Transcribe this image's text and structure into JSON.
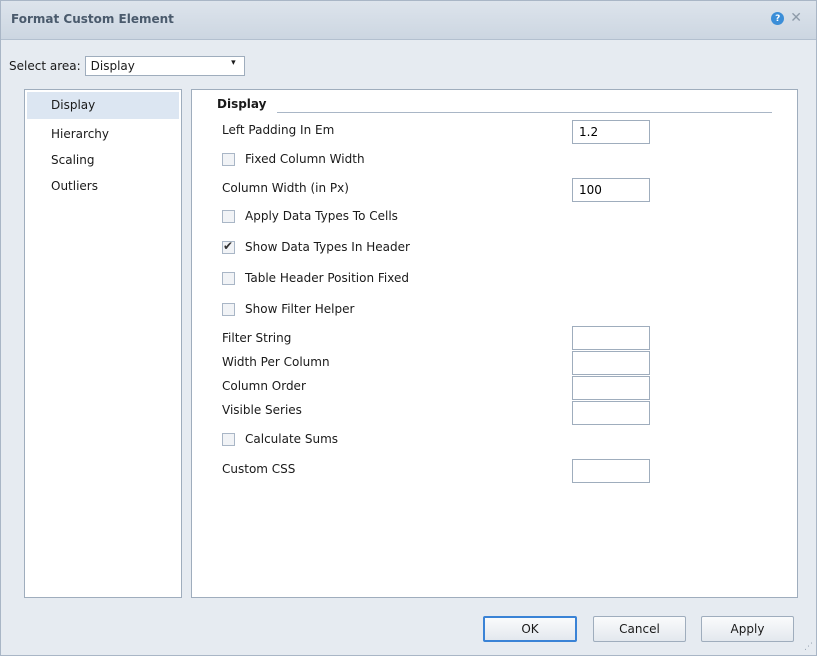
{
  "dialog": {
    "title": "Format Custom Element",
    "help_glyph": "?",
    "close_glyph": "✕"
  },
  "select_area": {
    "label": "Select area:",
    "value": "Display",
    "arrow": "▾"
  },
  "sidebar": {
    "items": [
      {
        "label": "Display",
        "active": true
      },
      {
        "label": "Hierarchy",
        "active": false
      },
      {
        "label": "Scaling",
        "active": false
      },
      {
        "label": "Outliers",
        "active": false
      }
    ]
  },
  "display": {
    "section_title": "Display",
    "left_padding": {
      "label": "Left Padding In Em",
      "value": "1.2"
    },
    "fixed_column_width": {
      "label": "Fixed Column Width",
      "checked": false
    },
    "column_width": {
      "label": "Column Width (in Px)",
      "value": "100"
    },
    "apply_data_types": {
      "label": "Apply Data Types To Cells",
      "checked": false
    },
    "show_data_types_header": {
      "label": "Show Data Types In Header",
      "checked": true
    },
    "table_header_fixed": {
      "label": "Table Header Position Fixed",
      "checked": false
    },
    "show_filter_helper": {
      "label": "Show Filter Helper",
      "checked": false
    },
    "filter_string": {
      "label": "Filter String",
      "value": ""
    },
    "width_per_column": {
      "label": "Width Per Column",
      "value": ""
    },
    "column_order": {
      "label": "Column Order",
      "value": ""
    },
    "visible_series": {
      "label": "Visible Series",
      "value": ""
    },
    "calculate_sums": {
      "label": "Calculate Sums",
      "checked": false
    },
    "custom_css": {
      "label": "Custom CSS",
      "value": ""
    }
  },
  "buttons": {
    "ok": "OK",
    "cancel": "Cancel",
    "apply": "Apply"
  }
}
